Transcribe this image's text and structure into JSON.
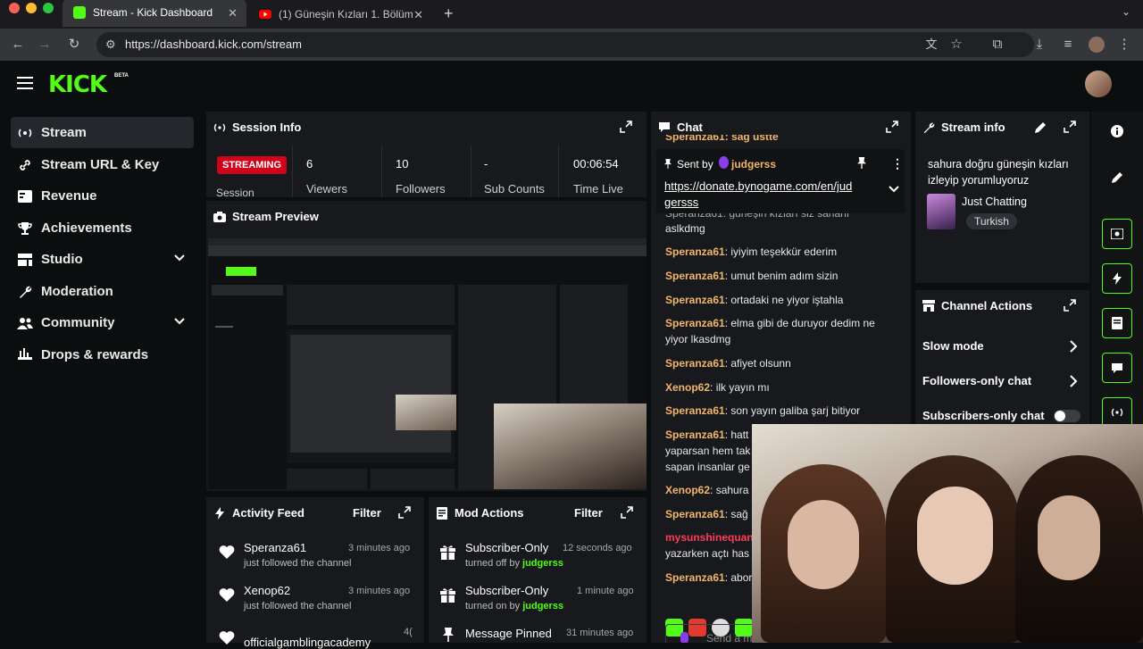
{
  "browser": {
    "tabs": [
      {
        "title": "Stream - Kick Dashboard",
        "active": true
      },
      {
        "title": "(1) Güneşin Kızları 1. Bölüm -",
        "active": false
      }
    ],
    "url": "https://dashboard.kick.com/stream"
  },
  "header": {
    "logo": "KICK",
    "logo_badge": "BETA"
  },
  "sidebar": {
    "items": [
      {
        "label": "Stream",
        "icon": "broadcast-icon",
        "active": true,
        "has_chevron": false
      },
      {
        "label": "Stream URL & Key",
        "icon": "link-icon",
        "active": false,
        "has_chevron": false
      },
      {
        "label": "Revenue",
        "icon": "revenue-icon",
        "active": false,
        "has_chevron": false
      },
      {
        "label": "Achievements",
        "icon": "trophy-icon",
        "active": false,
        "has_chevron": false
      },
      {
        "label": "Studio",
        "icon": "studio-icon",
        "active": false,
        "has_chevron": true
      },
      {
        "label": "Moderation",
        "icon": "wrench-icon",
        "active": false,
        "has_chevron": false
      },
      {
        "label": "Community",
        "icon": "community-icon",
        "active": false,
        "has_chevron": true
      },
      {
        "label": "Drops & rewards",
        "icon": "gift-icon",
        "active": false,
        "has_chevron": false
      }
    ]
  },
  "session": {
    "title": "Session Info",
    "badge": "STREAMING",
    "badge_label": "Session",
    "stats": [
      {
        "value": "6",
        "label": "Viewers"
      },
      {
        "value": "10",
        "label": "Followers"
      },
      {
        "value": "-",
        "label": "Sub Counts"
      },
      {
        "value": "00:06:54",
        "label": "Time Live"
      }
    ]
  },
  "preview": {
    "title": "Stream Preview"
  },
  "chat": {
    "title": "Chat",
    "top_cut": "Speranza61: sağ üstte",
    "pinned": {
      "sent_by_label": "Sent by",
      "user": "judgerss",
      "link": "https://donate.bynogame.com/en/judgersss",
      "link_line1": "https://donate.bynogame.com/en/jud",
      "link_line2": "gersss"
    },
    "partial_top": "Speranza61: güneşin kızları siz sahanı",
    "messages": [
      {
        "user": "",
        "text": "aslkdmg"
      },
      {
        "user": "Speranza61",
        "text": "iyiyim teşekkür ederim"
      },
      {
        "user": "Speranza61",
        "text": "umut benim adım sizin"
      },
      {
        "user": "Speranza61",
        "text": "ortadaki ne yiyor iştahla"
      },
      {
        "user": "Speranza61",
        "text": "elma gibi de duruyor dedim ne yiyor lkasdmg"
      },
      {
        "user": "Speranza61",
        "text": "afiyet olsunn"
      },
      {
        "user": "Xenop62",
        "text": "ilk yayın mı"
      },
      {
        "user": "Speranza61",
        "text": "son yayın galiba şarj bitiyor"
      },
      {
        "user": "Speranza61",
        "text": "hatt"
      },
      {
        "user": "",
        "text": "yaparsan hem tak"
      },
      {
        "user": "",
        "text": "sapan insanlar ge"
      },
      {
        "user": "Xenop62",
        "text": "sahura"
      },
      {
        "user": "Speranza61",
        "text": "sağ"
      },
      {
        "user": "mysunshinequan",
        "text": ""
      },
      {
        "user": "",
        "text": "yazarken açtı has"
      },
      {
        "user": "Speranza61",
        "text": "abor"
      }
    ],
    "input_placeholder": "Send a m"
  },
  "stream_info": {
    "title": "Stream info",
    "stream_title": "sahura doğru güneşin kızları izleyip yorumluyoruz",
    "category": "Just Chatting",
    "tag": "Turkish"
  },
  "channel_actions": {
    "title": "Channel Actions",
    "rows": [
      "Slow mode",
      "Followers-only chat",
      "Subscribers-only chat"
    ]
  },
  "activity": {
    "title": "Activity Feed",
    "filter": "Filter",
    "items": [
      {
        "name": "Speranza61",
        "sub": "just followed the channel",
        "time": "3 minutes ago"
      },
      {
        "name": "Xenop62",
        "sub": "just followed the channel",
        "time": "3 minutes ago"
      },
      {
        "name": "officialgamblingacademy",
        "sub": "",
        "time": "4("
      }
    ]
  },
  "mod_actions": {
    "title": "Mod Actions",
    "filter": "Filter",
    "items": [
      {
        "name": "Subscriber-Only",
        "sub": "turned off by",
        "by": "judgerss",
        "time": "12 seconds ago",
        "icon": "gift-icon"
      },
      {
        "name": "Subscriber-Only",
        "sub": "turned on by",
        "by": "judgerss",
        "time": "1 minute ago",
        "icon": "gift-icon"
      },
      {
        "name": "Message Pinned",
        "sub": "",
        "by": "",
        "time": "31 minutes ago",
        "icon": "pin-icon"
      }
    ]
  },
  "colors": {
    "accent": "#53fc18",
    "username": "#f2b66b",
    "red_user": "#ff3b5c",
    "badge_red": "#d0021b"
  }
}
